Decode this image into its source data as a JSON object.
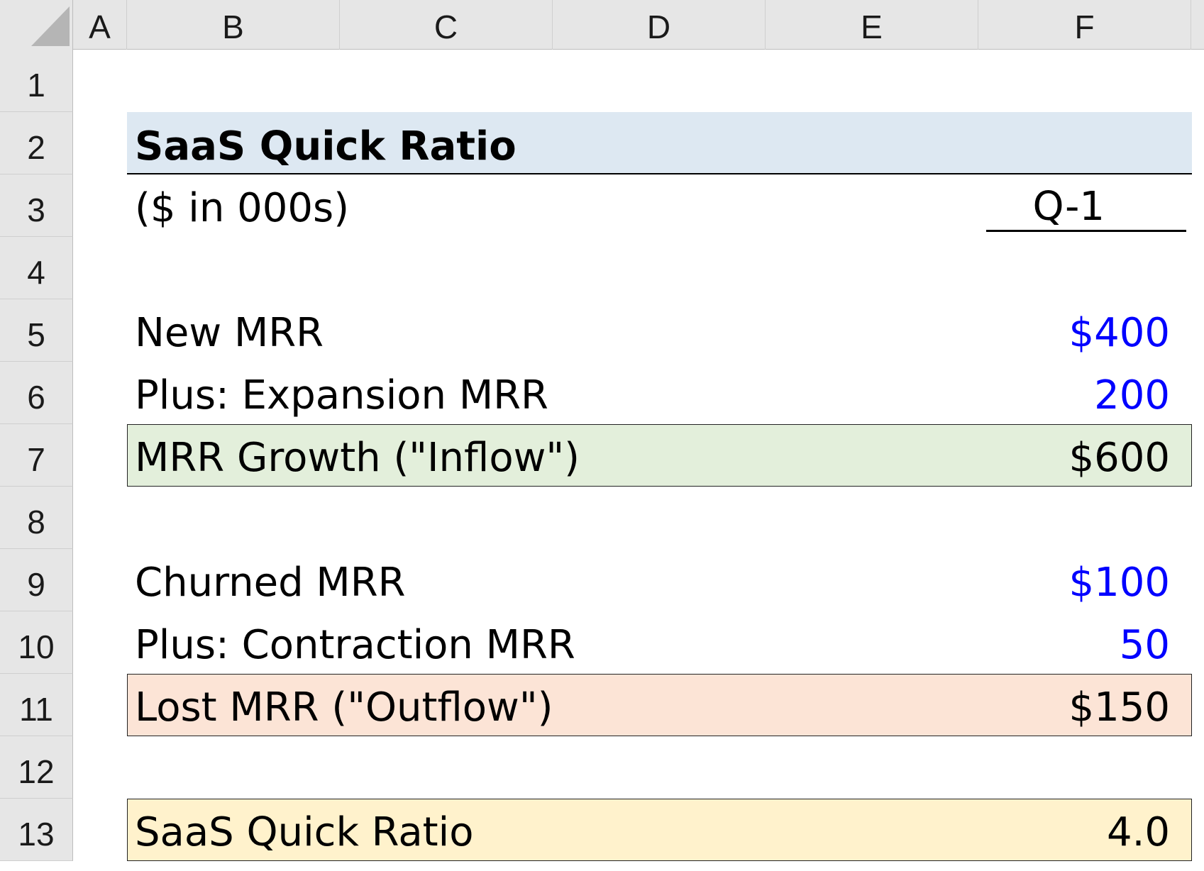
{
  "columns": [
    "A",
    "B",
    "C",
    "D",
    "E",
    "F"
  ],
  "rows": [
    "1",
    "2",
    "3",
    "4",
    "5",
    "6",
    "7",
    "8",
    "9",
    "10",
    "11",
    "12",
    "13"
  ],
  "model": {
    "title": "SaaS Quick Ratio",
    "units": "($ in 000s)",
    "period": "Q-1",
    "new_mrr": {
      "label": "New MRR",
      "value": "$400"
    },
    "expansion_mrr": {
      "label": "Plus: Expansion MRR",
      "value": "200"
    },
    "mrr_growth": {
      "label": "MRR Growth (\"Inflow\")",
      "value": "$600"
    },
    "churned_mrr": {
      "label": "Churned MRR",
      "value": "$100"
    },
    "contraction_mrr": {
      "label": "Plus: Contraction MRR",
      "value": "50"
    },
    "lost_mrr": {
      "label": "Lost MRR (\"Outflow\")",
      "value": "$150"
    },
    "quick_ratio": {
      "label": "SaaS Quick Ratio",
      "value": "4.0"
    }
  },
  "colors": {
    "input_font": "#0000ff",
    "title_fill": "#dde8f2",
    "inflow_fill": "#e3efdb",
    "outflow_fill": "#fce4d6",
    "ratio_fill": "#fff2cc",
    "header_fill": "#e6e6e6"
  }
}
